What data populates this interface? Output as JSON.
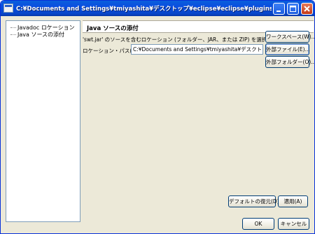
{
  "window": {
    "title": "C:¥Documents and Settings¥tmiyashita¥デスクトップ¥eclipse¥eclipse¥plugins¥org.eclipse.swt.w...",
    "accent": "#0a4ee0"
  },
  "tree": {
    "items": [
      {
        "label": "Javadoc ロケーション"
      },
      {
        "label": "Java ソースの添付"
      }
    ]
  },
  "page": {
    "title": "Java ソースの添付",
    "description": "'swt.jar' のソースを含むロケーション (フォルダー、JAR、または ZIP) を選択してください:",
    "location_label": "ロケーション・パス(C):",
    "location_value": "C:¥Documents and Settings¥tmiyashita¥デスクトップ¥eclipse¥",
    "workspace_button": "ワークスペース(W)...",
    "external_file_button": "外部ファイル(E)...",
    "external_folder_button": "外部フォルダー(O)..."
  },
  "footer": {
    "restore_defaults": "デフォルトの復元(D)",
    "apply": "適用(A)",
    "ok": "OK",
    "cancel": "キャンセル"
  }
}
